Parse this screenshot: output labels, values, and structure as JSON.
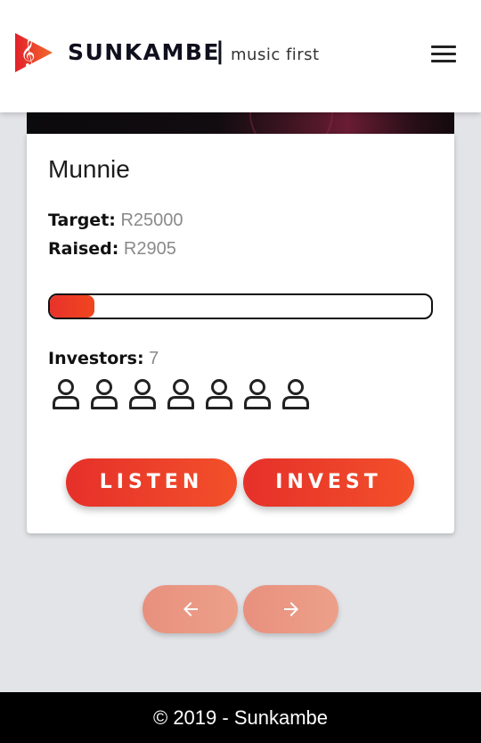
{
  "header": {
    "brand": "SUNKAMBE",
    "separator": "|",
    "tagline": "music first",
    "logo_icon": "music-play-logo-icon",
    "menu_icon": "hamburger-menu-icon",
    "accent_color": "#e8322c"
  },
  "card": {
    "artist_name": "Munnie",
    "target_label": "Target:",
    "target_value": "R25000",
    "raised_label": "Raised:",
    "raised_value": "R2905",
    "progress_fraction": 0.116,
    "investors_label": "Investors:",
    "investors_count": "7",
    "investor_icon": "person-icon",
    "listen_label": "LISTEN",
    "invest_label": "INVEST"
  },
  "pagination": {
    "prev_icon": "arrow-left-icon",
    "next_icon": "arrow-right-icon"
  },
  "footer": {
    "copyright": "© 2019 - Sunkambe"
  }
}
